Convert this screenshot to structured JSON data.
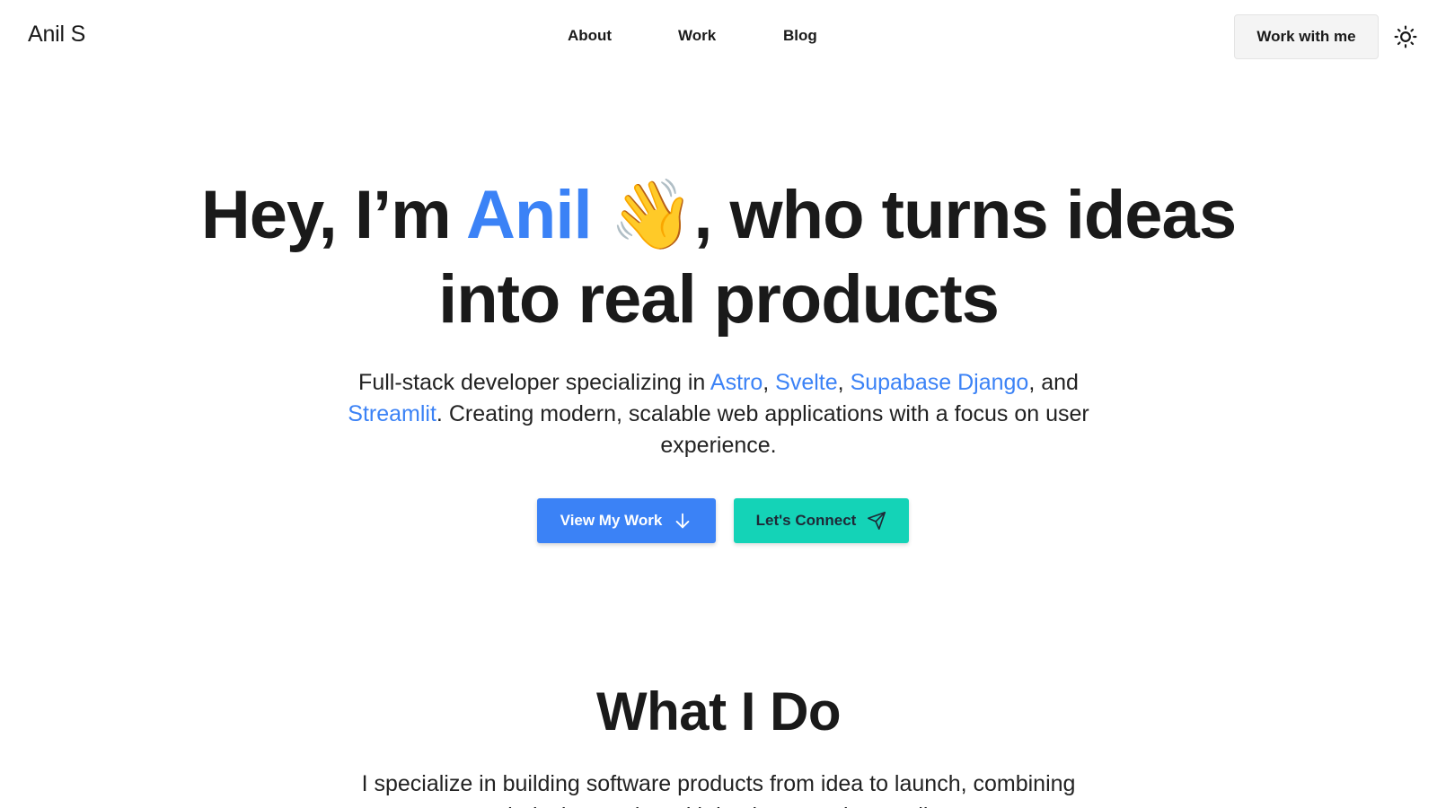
{
  "header": {
    "logo": "Anil S",
    "nav": [
      "About",
      "Work",
      "Blog"
    ],
    "cta_label": "Work with me",
    "theme_icon": "sun-icon"
  },
  "hero": {
    "title_part1": "Hey, I’m ",
    "title_name": "Anil",
    "title_emoji": "👋",
    "title_part2": ", who turns ideas",
    "title_line2": "into real products",
    "subtitle": {
      "t1": "Full-stack developer specializing in ",
      "tech1": "Astro",
      "t2": ", ",
      "tech2": "Svelte",
      "t3": ", ",
      "tech3": "Supabase Django",
      "t4": ", and ",
      "tech4": "Streamlit",
      "t5": ". Creating modern, scalable web applications with a focus on user experience."
    },
    "primary_button": "View My Work",
    "primary_icon": "arrow-down-icon",
    "secondary_button": "Let's Connect",
    "secondary_icon": "send-icon"
  },
  "section": {
    "title": "What I Do",
    "text": "I specialize in building software products from idea to launch, combining technical expertise with business understanding."
  },
  "colors": {
    "accent": "#3b82f6",
    "secondary_button": "#14d3b7",
    "text": "#1a1a1a"
  }
}
